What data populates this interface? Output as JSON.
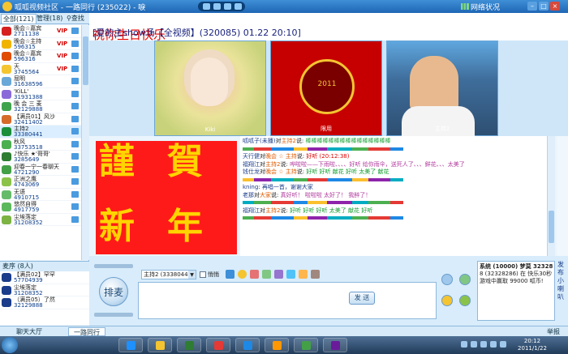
{
  "window": {
    "title": "呱呱视频社区 - 一路同行 (235022) - 唳",
    "network_status": "网络状况"
  },
  "left_panel": {
    "tabs": [
      {
        "label": "全部(121)"
      },
      {
        "label": "管理(18)"
      },
      {
        "label": "查找"
      }
    ],
    "users": [
      {
        "name": "晚会☆嘉宾",
        "id": "2711138",
        "tag": "VIP",
        "avatar_color": "#d62020"
      },
      {
        "name": "晚会☆主持",
        "id": "596315",
        "tag": "VIP",
        "avatar_color": "#f0b400"
      },
      {
        "name": "晚会☆嘉宾",
        "id": "596316",
        "tag": "VIP",
        "avatar_color": "#e04c00"
      },
      {
        "name": "天",
        "id": "3745564",
        "tag": "VIP",
        "avatar_color": "#f4c431"
      },
      {
        "name": "屈明",
        "id": "31638596",
        "tag": "",
        "avatar_color": "#6aa7d9"
      },
      {
        "name": "'KiLL'",
        "id": "31931388",
        "tag": "",
        "avatar_color": "#8a6ad9"
      },
      {
        "name": "晚 会 三 麦",
        "id": "32129888",
        "tag": "",
        "avatar_color": "#3fa34d"
      },
      {
        "name": "【满员01】风沙",
        "id": "32411402",
        "tag": "",
        "avatar_color": "#d66a2a"
      },
      {
        "name": "主持2",
        "id": "33380441",
        "tag": "",
        "avatar_color": "#1a8e3a"
      },
      {
        "name": "秋风",
        "id": "33753518",
        "tag": "",
        "avatar_color": "#4caf50"
      },
      {
        "name": "♪快乐 ★'哥哥'",
        "id": "3285649",
        "tag": "",
        "avatar_color": "#2e7d32"
      },
      {
        "name": "迎春一宁一春聊天",
        "id": "4721290",
        "tag": "",
        "avatar_color": "#43a047"
      },
      {
        "name": "正洲之鹰",
        "id": "4743069",
        "tag": "",
        "avatar_color": "#8bc34a"
      },
      {
        "name": "无语",
        "id": "4910715",
        "tag": "",
        "avatar_color": "#66bb6a"
      },
      {
        "name": "悠然自得",
        "id": "4917759",
        "tag": "",
        "avatar_color": "#5cb85c"
      },
      {
        "name": "尘埃落定",
        "id": "31208352",
        "tag": "",
        "avatar_color": "#7cb342"
      }
    ],
    "waiting_header": "麦序 (8人)",
    "waiting": [
      {
        "name": "【满员02】罕罕",
        "id": "57704939"
      },
      {
        "name": "尘埃落定",
        "id": "31208352"
      },
      {
        "name": "（满员05）了然",
        "id": "32129888"
      }
    ]
  },
  "banner": {
    "highlight": "祝你生日快乐",
    "rest": "[爱的主show场【全视频】(320085) 01.22 20:10]"
  },
  "cameras": [
    {
      "label": "Kiki"
    },
    {
      "label": "限用",
      "year": "2011"
    },
    {
      "label": "主持2"
    }
  ],
  "gift_image": {
    "chars": [
      "謹",
      "賀",
      "新",
      "年"
    ]
  },
  "chat": {
    "messages": [
      {
        "user": "呱呱子(未播)",
        "to": "主持2",
        "text": "棒棒棒棒棒棒棒棒棒棒棒棒棒棒棒"
      },
      {
        "user": "天行健",
        "to": "晚会 ☆ 主持",
        "text": "好听 (20:12:38)"
      },
      {
        "user": "福翔江",
        "to": "主持2",
        "text": "哗啦啦——下雨啦、、、、好听 给你雨伞，送死人了、、、鲜花、、、太美了"
      },
      {
        "user": "钱仕龙",
        "to": "晚会 ☆ 主持",
        "text": "好听 好听 献花 好听 太美了 献花"
      },
      {
        "user": "kning",
        "to": "",
        "text": "再唱一首，谢谢大家"
      },
      {
        "user": "老那",
        "to": "大家",
        "text": "真好听！ 啦啦啦 太好了！ 我醉了！"
      },
      {
        "user": "福翔江",
        "to": "主持2",
        "text": "好听 好听 好听 太美了 献花 好听"
      }
    ]
  },
  "input": {
    "to_select": "主持2 (33380441)",
    "private_label": "悄悄",
    "send_label": "发 送",
    "mic_label": "排麦"
  },
  "system_box": {
    "title": "系统 (10000) 梦莫 3232828",
    "body": "8 (32328286) 在 快乐30秒 游戏中赢取 99000 呱币!",
    "side_label": "发布小喇叭"
  },
  "statusbar": {
    "tabs": [
      "聊天大厅",
      "一路同行"
    ],
    "right": "举报"
  },
  "taskbar": {
    "time": "20:12",
    "date": "2011/1/22",
    "colors": [
      "#1e90ff",
      "#f4c431",
      "#2e7d32",
      "#e53935",
      "#1e88e5",
      "#ff9800",
      "#43a047",
      "#6a1b9a"
    ]
  }
}
